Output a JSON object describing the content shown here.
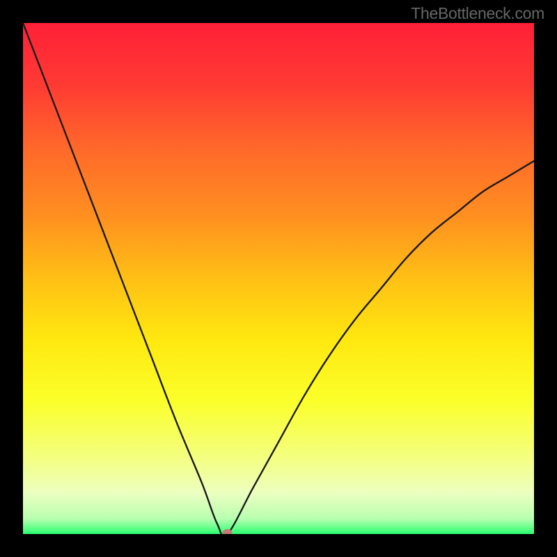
{
  "watermark": "TheBottleneck.com",
  "chart_data": {
    "type": "line",
    "title": "",
    "xlabel": "",
    "ylabel": "",
    "xlim": [
      0,
      100
    ],
    "ylim": [
      0,
      100
    ],
    "grid": false,
    "legend": false,
    "series": [
      {
        "name": "bottleneck-curve",
        "x": [
          0,
          5,
          10,
          15,
          20,
          25,
          30,
          35,
          38,
          40,
          45,
          50,
          55,
          60,
          65,
          70,
          75,
          80,
          85,
          90,
          95,
          100
        ],
        "values": [
          100,
          87,
          74,
          61,
          48,
          35,
          22,
          10,
          2,
          0,
          9,
          18,
          27,
          35,
          42,
          48,
          54,
          59,
          63,
          67,
          70,
          73
        ]
      }
    ],
    "marker": {
      "x": 40,
      "y": 0,
      "rx": 7,
      "ry": 5,
      "color": "#c77a7a"
    },
    "gradient_stops": [
      {
        "offset": 0.0,
        "color": "#ff2038"
      },
      {
        "offset": 0.12,
        "color": "#ff3a33"
      },
      {
        "offset": 0.25,
        "color": "#ff6a2a"
      },
      {
        "offset": 0.38,
        "color": "#ff9020"
      },
      {
        "offset": 0.5,
        "color": "#ffc015"
      },
      {
        "offset": 0.62,
        "color": "#ffe810"
      },
      {
        "offset": 0.74,
        "color": "#fbff2a"
      },
      {
        "offset": 0.85,
        "color": "#f4ff80"
      },
      {
        "offset": 0.92,
        "color": "#ecffc0"
      },
      {
        "offset": 0.97,
        "color": "#b8ffb0"
      },
      {
        "offset": 1.0,
        "color": "#2aff70"
      }
    ],
    "curve_stroke": "#1a1a1a",
    "curve_width": 2.4
  }
}
